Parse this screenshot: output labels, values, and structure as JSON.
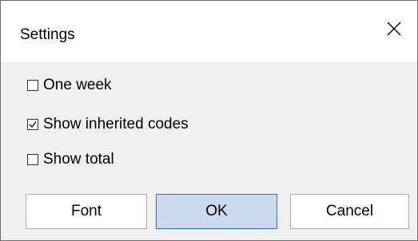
{
  "window": {
    "title": "Settings",
    "close_icon": "close-icon"
  },
  "options": [
    {
      "label": "One week",
      "checked": false
    },
    {
      "label": "Show inherited codes",
      "checked": true
    },
    {
      "label": "Show total",
      "checked": false
    }
  ],
  "buttons": {
    "font_label": "Font",
    "ok_label": "OK",
    "cancel_label": "Cancel"
  },
  "colors": {
    "dialog_bg": "#f0f0f0",
    "titlebar_bg": "#ffffff",
    "ok_accent_bg": "#ccdcee",
    "ok_accent_border": "#2f6fd6"
  }
}
